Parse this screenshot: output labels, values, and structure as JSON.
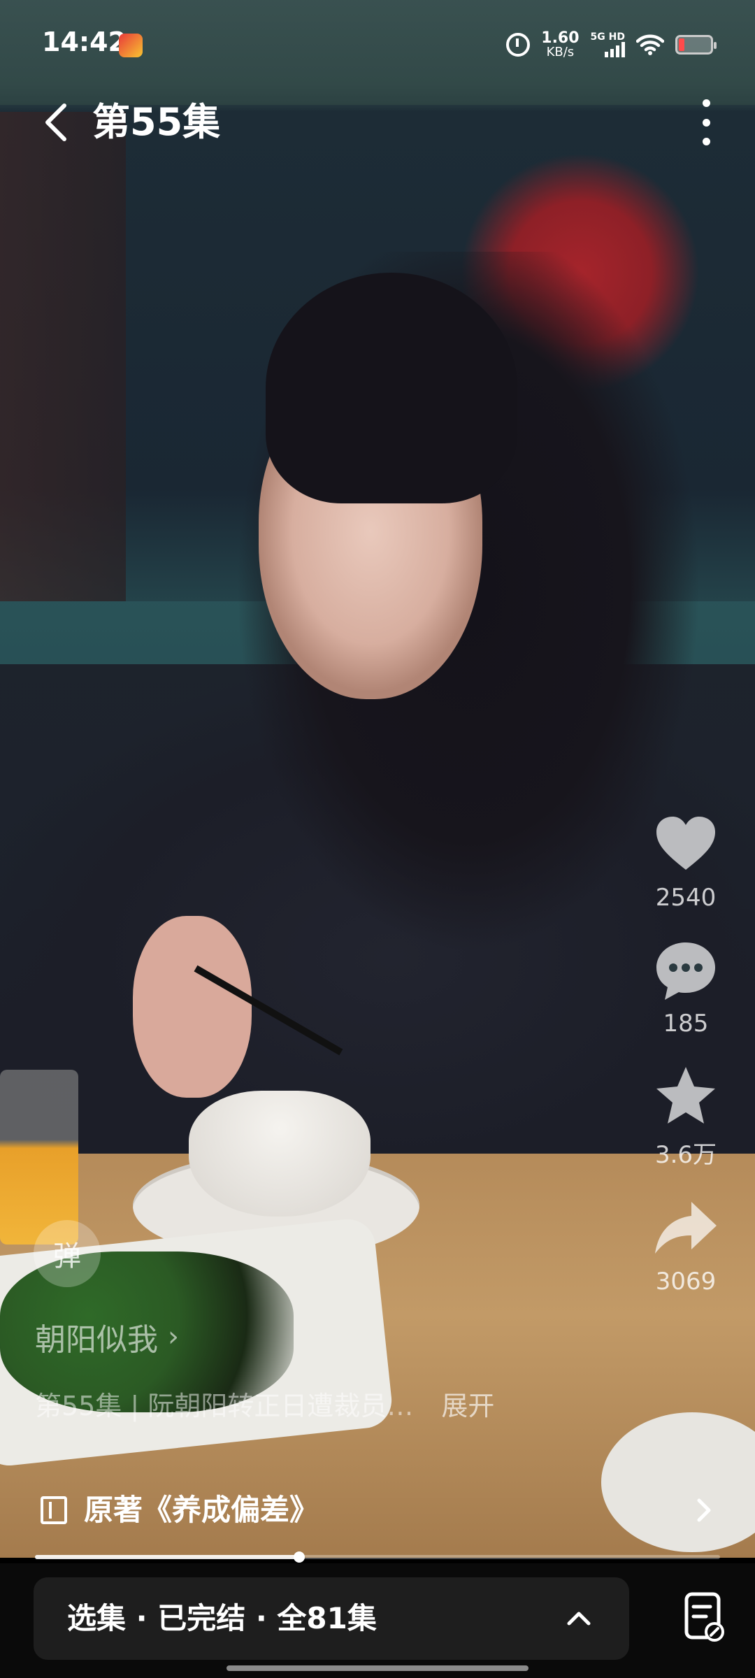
{
  "status_bar": {
    "time": "14:42",
    "net_speed_value": "1.60",
    "net_speed_unit": "KB/s",
    "network_label": "5G HD"
  },
  "header": {
    "title": "第55集"
  },
  "actions": {
    "like_count": "2540",
    "comment_count": "185",
    "favorite_count": "3.6万",
    "share_count": "3069"
  },
  "danmu_label": "弹",
  "caption": {
    "author": "朝阳似我",
    "author_arrow": "›",
    "description": "第55集 | 阮朝阳转正日遭裁员…",
    "expand_label": "展开"
  },
  "novel_banner": {
    "label": "原著《养成偏差》"
  },
  "playback": {
    "progress_fraction": 0.386
  },
  "bottom_bar": {
    "episodes_label": "选集 · 已完结 · 全81集"
  },
  "colors": {
    "accent": "#ffffff",
    "bottom_bar_bg": "#0a0a0a",
    "episodes_button_bg": "#1e1e1e"
  },
  "icons": [
    "back-icon",
    "more-icon",
    "heart-icon",
    "comment-icon",
    "star-icon",
    "share-icon",
    "book-icon",
    "chevron-right-icon",
    "chevron-up-icon",
    "notes-icon",
    "alarm-icon",
    "wifi-icon",
    "battery-icon"
  ]
}
